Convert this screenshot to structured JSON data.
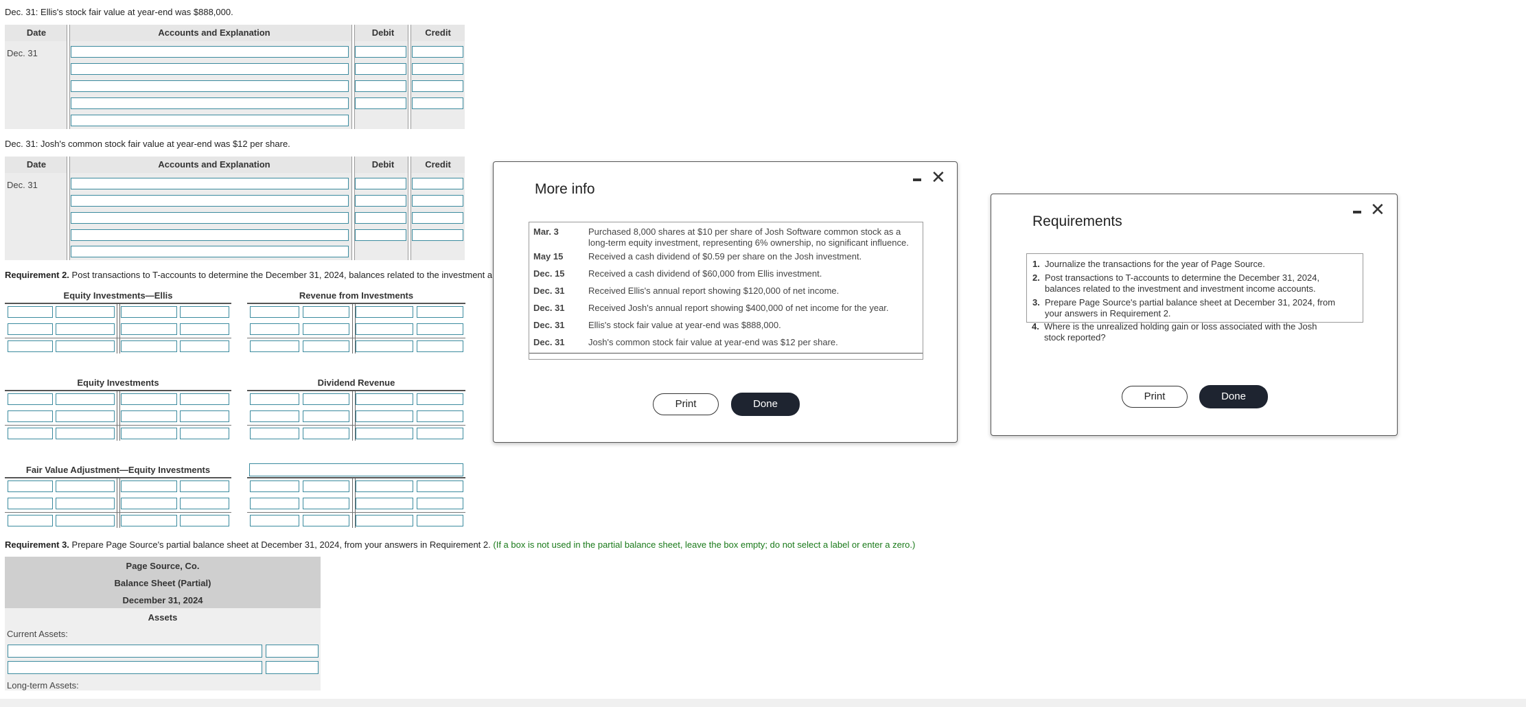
{
  "journal1": {
    "prompt": "Dec. 31: Ellis's stock fair value at year-end was $888,000.",
    "headers": {
      "date": "Date",
      "accounts": "Accounts and Explanation",
      "debit": "Debit",
      "credit": "Credit"
    },
    "date": "Dec. 31"
  },
  "journal2": {
    "prompt": "Dec. 31: Josh's common stock fair value at year-end was $12 per share.",
    "headers": {
      "date": "Date",
      "accounts": "Accounts and Explanation",
      "debit": "Debit",
      "credit": "Credit"
    },
    "date": "Dec. 31"
  },
  "requirement2": {
    "label": "Requirement 2.",
    "text": "Post transactions to T-accounts to determine the December 31, 2024, balances related to the investment a"
  },
  "taccounts": {
    "equity_ellis": "Equity Investments—Ellis",
    "revenue_investments": "Revenue from Investments",
    "equity_investments": "Equity Investments",
    "dividend_revenue": "Dividend Revenue",
    "fair_value_adjustment": "Fair Value Adjustment—Equity Investments"
  },
  "requirement3": {
    "label": "Requirement 3.",
    "text": "Prepare Page Source's partial balance sheet at December 31, 2024, from your answers in Requirement 2.",
    "hint": "(If a box is not used in the partial balance sheet, leave the box empty; do not select a label or enter a zero.)"
  },
  "balance_sheet": {
    "company": "Page Source, Co.",
    "title": "Balance Sheet (Partial)",
    "date": "December 31, 2024",
    "section": "Assets",
    "current_assets": "Current Assets:",
    "long_term_assets": "Long-term Assets:"
  },
  "more_info": {
    "title": "More info",
    "rows": [
      {
        "date": "Mar. 3",
        "text1": "Purchased 8,000 shares at $10 per share of Josh Software common stock as a",
        "text2": "long-term equity investment, representing 6% ownership, no significant influence."
      },
      {
        "date": "May 15",
        "text1": "Received a cash dividend of $0.59 per share on the Josh investment.",
        "text2": ""
      },
      {
        "date": "Dec. 15",
        "text1": "Received a cash dividend of $60,000 from Ellis investment.",
        "text2": ""
      },
      {
        "date": "Dec. 31",
        "text1": "Received Ellis's annual report showing $120,000 of net income.",
        "text2": ""
      },
      {
        "date": "Dec. 31",
        "text1": "Received Josh's annual report showing $400,000 of net income for the year.",
        "text2": ""
      },
      {
        "date": "Dec. 31",
        "text1": "Ellis's stock fair value at year-end was $888,000.",
        "text2": ""
      },
      {
        "date": "Dec. 31",
        "text1": "Josh's common stock fair value at year-end was $12 per share.",
        "text2": ""
      }
    ],
    "print": "Print",
    "done": "Done"
  },
  "requirements": {
    "title": "Requirements",
    "items": [
      {
        "num": "1.",
        "line1": "Journalize the transactions for the year of Page Source.",
        "line2": ""
      },
      {
        "num": "2.",
        "line1": "Post transactions to T-accounts to determine the December 31, 2024,",
        "line2": "balances related to the investment and investment income accounts."
      },
      {
        "num": "3.",
        "line1": "Prepare Page Source's partial balance sheet at December 31, 2024, from",
        "line2": "your answers in Requirement 2."
      },
      {
        "num": "4.",
        "line1": "Where is the unrealized holding gain or loss associated with the Josh",
        "line2": "stock reported?"
      }
    ],
    "print": "Print",
    "done": "Done"
  }
}
